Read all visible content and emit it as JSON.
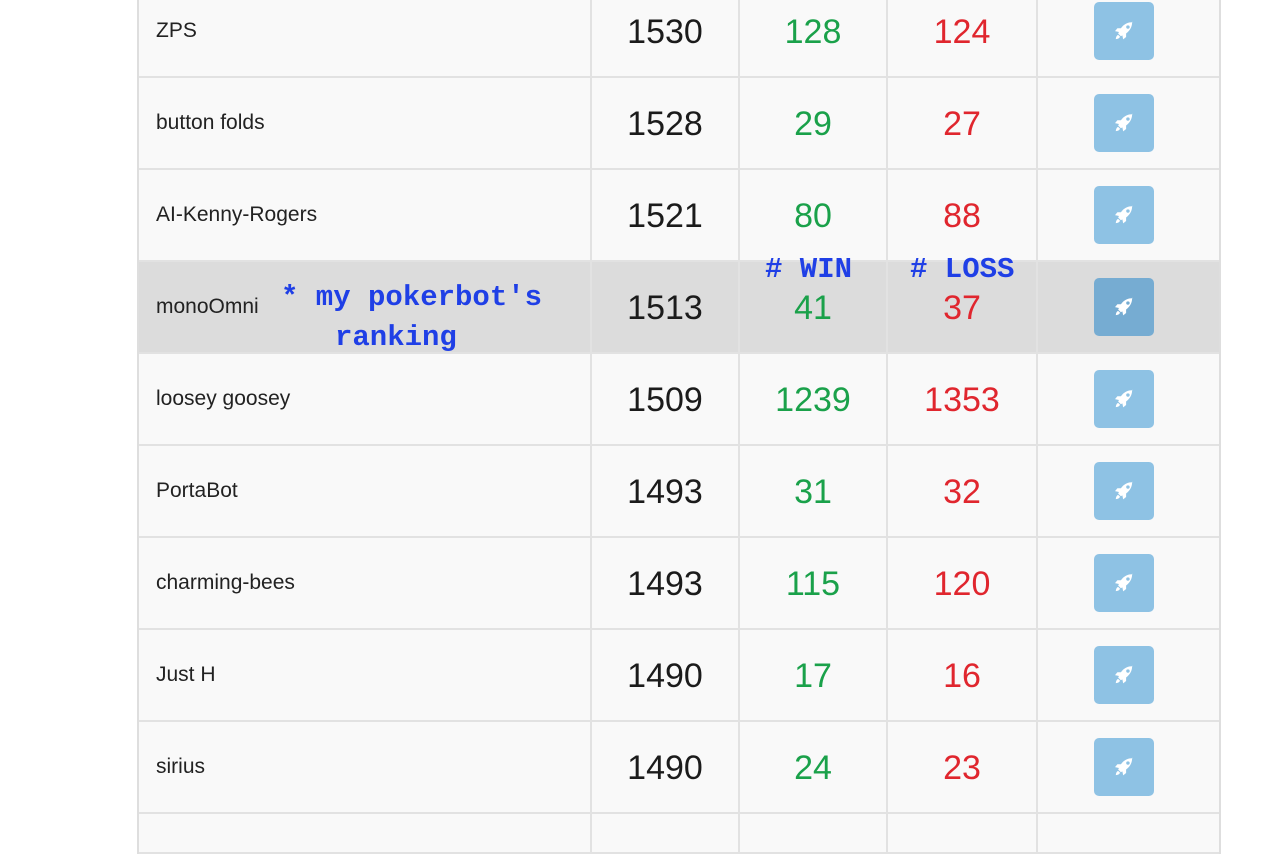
{
  "leaderboard": {
    "rows": [
      {
        "name": "ZPS",
        "rating": "1530",
        "wins": "128",
        "losses": "124"
      },
      {
        "name": "button folds",
        "rating": "1528",
        "wins": "29",
        "losses": "27"
      },
      {
        "name": "AI-Kenny-Rogers",
        "rating": "1521",
        "wins": "80",
        "losses": "88"
      },
      {
        "name": "monoOmni",
        "rating": "1513",
        "wins": "41",
        "losses": "37",
        "highlighted": true
      },
      {
        "name": "loosey goosey",
        "rating": "1509",
        "wins": "1239",
        "losses": "1353"
      },
      {
        "name": "PortaBot",
        "rating": "1493",
        "wins": "31",
        "losses": "32"
      },
      {
        "name": "charming-bees",
        "rating": "1493",
        "wins": "115",
        "losses": "120"
      },
      {
        "name": "Just H",
        "rating": "1490",
        "wins": "17",
        "losses": "16"
      },
      {
        "name": "sirius",
        "rating": "1490",
        "wins": "24",
        "losses": "23"
      }
    ],
    "action_icon": "rocket-icon"
  },
  "annotations": {
    "note_line1": "* my pokerbot's",
    "note_line2": "ranking",
    "win_label": "# WIN",
    "loss_label": "# LOSS"
  },
  "colors": {
    "win": "#1aa14a",
    "loss": "#e0262e",
    "button": "#8ec2e4",
    "button_highlight": "#76acd2",
    "highlight_row": "#dcdcdc",
    "annotation": "#1f3fe6"
  }
}
